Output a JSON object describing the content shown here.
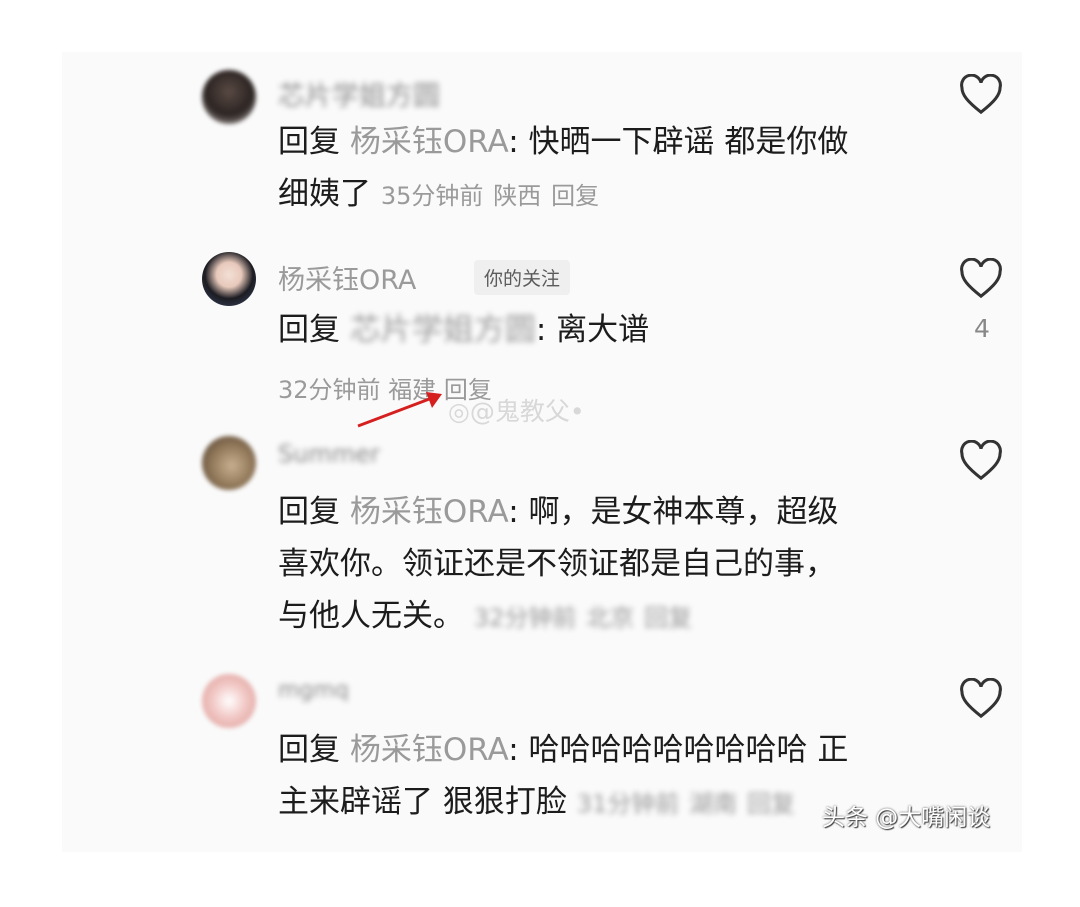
{
  "comments": [
    {
      "username": "芯片学姐方圆",
      "reply_word": "回复",
      "reply_to": "杨采钰ORA",
      "text_line1": "快晒一下辟谣 都是你做",
      "text_line2": "细姨了",
      "time": "35分钟前",
      "location": "陕西",
      "reply_action": "回复",
      "like_count": ""
    },
    {
      "username": "杨采钰ORA",
      "badge": "你的关注",
      "reply_word": "回复",
      "reply_to": "芯片学姐方圆",
      "text_line1": "离大谱",
      "time": "32分钟前",
      "location": "福建",
      "reply_action": "回复",
      "like_count": "4"
    },
    {
      "username": "Summer",
      "reply_word": "回复",
      "reply_to": "杨采钰ORA",
      "text_line1": "啊，是女神本尊，超级",
      "text_line2": "喜欢你。领证还是不领证都是自己的事，",
      "text_line3": "与他人无关。",
      "time": "32分钟前",
      "location": "北京",
      "reply_action": "回复",
      "like_count": ""
    },
    {
      "username": "mgmq",
      "reply_word": "回复",
      "reply_to": "杨采钰ORA",
      "text_line1": "哈哈哈哈哈哈哈哈哈 正",
      "text_line2": "主来辟谣了 狠狠打脸",
      "time": "31分钟前",
      "location": "湖南",
      "reply_action": "回复",
      "like_count": ""
    }
  ],
  "watermarks": {
    "weibo": "@鬼教父",
    "toutiao": "头条 @大嘴闲谈"
  },
  "colors": {
    "annotation_arrow": "#d62020",
    "heart_stroke": "#333333"
  }
}
